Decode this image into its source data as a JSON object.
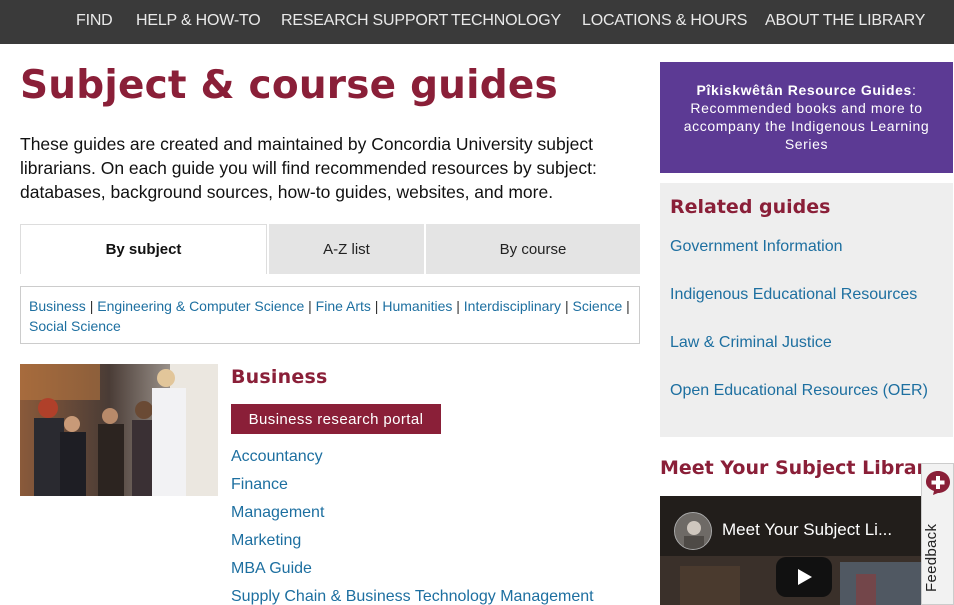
{
  "nav": {
    "items": [
      "FIND",
      "HELP & HOW-TO",
      "RESEARCH SUPPORT",
      "TECHNOLOGY",
      "LOCATIONS & HOURS",
      "ABOUT THE LIBRARY"
    ]
  },
  "page": {
    "title": "Subject & course guides",
    "intro": "These guides are created and maintained by Concordia University subject librarians. On each guide you will find recommended resources by subject: databases, background sources, how-to guides, websites, and more."
  },
  "tabs": [
    {
      "label": "By subject",
      "active": true
    },
    {
      "label": "A-Z list",
      "active": false
    },
    {
      "label": "By course",
      "active": false
    }
  ],
  "filters": [
    "Business",
    "Engineering & Computer Science",
    "Fine Arts",
    "Humanities",
    "Interdisciplinary",
    "Science",
    "Social Science"
  ],
  "business": {
    "title": "Business",
    "portal_button": "Business research portal",
    "links": [
      "Accountancy",
      "Finance",
      "Management",
      "Marketing",
      "MBA Guide",
      "Supply Chain & Business Technology Management"
    ]
  },
  "sidebar": {
    "promo": {
      "bold": "Pîkiskwêtân Resource Guides",
      "rest": "Recommended books and more to accompany the Indigenous Learning Series"
    },
    "related_title": "Related guides",
    "related_links": [
      "Government Information",
      "Indigenous Educational Resources",
      "Law & Criminal Justice",
      "Open Educational Resources (OER)"
    ],
    "meet_title": "Meet Your Subject Librarian",
    "video_title": "Meet Your Subject Li..."
  },
  "feedback": {
    "label": "Feedback"
  },
  "colors": {
    "brand": "#8a1f38",
    "link": "#1d6fa0",
    "promo": "#5c3a94",
    "nav": "#3a3a3a"
  }
}
